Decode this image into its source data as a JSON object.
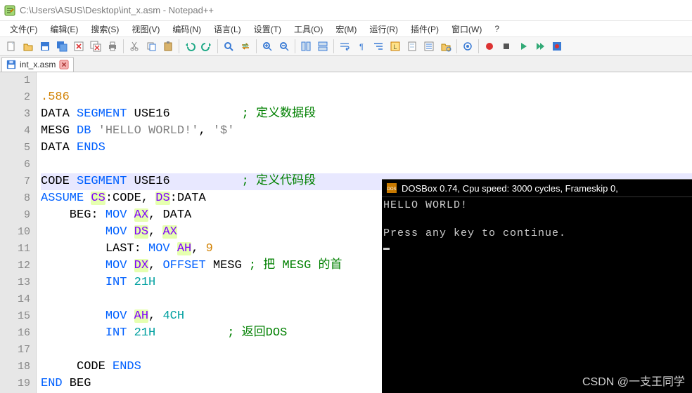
{
  "title": "C:\\Users\\ASUS\\Desktop\\int_x.asm - Notepad++",
  "menus": [
    "文件(F)",
    "编辑(E)",
    "搜索(S)",
    "视图(V)",
    "编码(N)",
    "语言(L)",
    "设置(T)",
    "工具(O)",
    "宏(M)",
    "运行(R)",
    "插件(P)",
    "窗口(W)",
    "?"
  ],
  "tab": {
    "label": "int_x.asm"
  },
  "toolbar_icons": [
    "new-file-icon",
    "open-icon",
    "save-icon",
    "save-all-icon",
    "close-icon",
    "close-all-icon",
    "print-icon",
    "sep",
    "cut-icon",
    "copy-icon",
    "paste-icon",
    "sep",
    "undo-icon",
    "redo-icon",
    "sep",
    "find-icon",
    "replace-icon",
    "sep",
    "zoom-in-icon",
    "zoom-out-icon",
    "sep",
    "sync-v-icon",
    "sync-h-icon",
    "sep",
    "wordwrap-icon",
    "show-all-icon",
    "indent-guide-icon",
    "lang-icon",
    "doc-map-icon",
    "func-list-icon",
    "folder-icon",
    "sep",
    "monitor-icon",
    "sep",
    "record-icon",
    "stop-icon",
    "play-icon",
    "play-multi-icon",
    "save-macro-icon"
  ],
  "code": {
    "lines": [
      {
        "n": 1,
        "hl": false,
        "t": []
      },
      {
        "n": 2,
        "hl": false,
        "t": [
          {
            "c": "f-orange",
            "s": ".586"
          }
        ]
      },
      {
        "n": 3,
        "hl": false,
        "t": [
          {
            "c": "f-black",
            "s": "DATA "
          },
          {
            "c": "f-blue",
            "s": "SEGMENT"
          },
          {
            "c": "f-black",
            "s": " USE16          "
          },
          {
            "c": "f-green",
            "s": "; 定义数据段"
          }
        ]
      },
      {
        "n": 4,
        "hl": false,
        "t": [
          {
            "c": "f-black",
            "s": "MESG "
          },
          {
            "c": "f-blue",
            "s": "DB"
          },
          {
            "c": "f-grey",
            "s": " 'HELLO WORLD!'"
          },
          {
            "c": "f-black",
            "s": ", "
          },
          {
            "c": "f-grey",
            "s": "'$'"
          }
        ]
      },
      {
        "n": 5,
        "hl": false,
        "t": [
          {
            "c": "f-black",
            "s": "DATA "
          },
          {
            "c": "f-blue",
            "s": "ENDS"
          }
        ]
      },
      {
        "n": 6,
        "hl": false,
        "t": []
      },
      {
        "n": 7,
        "hl": true,
        "t": [
          {
            "c": "f-black",
            "s": "CODE "
          },
          {
            "c": "f-blue",
            "s": "SEGMENT"
          },
          {
            "c": "f-black",
            "s": " USE16          "
          },
          {
            "c": "f-green",
            "s": "; 定义代码段"
          }
        ]
      },
      {
        "n": 8,
        "hl": false,
        "t": [
          {
            "c": "f-blue",
            "s": "ASSUME"
          },
          {
            "c": "f-black",
            "s": " "
          },
          {
            "c": "f-purple mark",
            "s": "CS"
          },
          {
            "c": "f-black",
            "s": ":CODE, "
          },
          {
            "c": "f-purple mark",
            "s": "DS"
          },
          {
            "c": "f-black",
            "s": ":DATA"
          }
        ]
      },
      {
        "n": 9,
        "hl": false,
        "t": [
          {
            "c": "f-black",
            "s": "    BEG: "
          },
          {
            "c": "f-blue",
            "s": "MOV"
          },
          {
            "c": "f-black",
            "s": " "
          },
          {
            "c": "f-purple mark",
            "s": "AX"
          },
          {
            "c": "f-black",
            "s": ", DATA"
          }
        ]
      },
      {
        "n": 10,
        "hl": false,
        "t": [
          {
            "c": "f-black",
            "s": "         "
          },
          {
            "c": "f-blue",
            "s": "MOV"
          },
          {
            "c": "f-black",
            "s": " "
          },
          {
            "c": "f-purple mark",
            "s": "DS"
          },
          {
            "c": "f-black",
            "s": ", "
          },
          {
            "c": "f-purple mark",
            "s": "AX"
          }
        ]
      },
      {
        "n": 11,
        "hl": false,
        "t": [
          {
            "c": "f-black",
            "s": "         LAST: "
          },
          {
            "c": "f-blue",
            "s": "MOV"
          },
          {
            "c": "f-black",
            "s": " "
          },
          {
            "c": "f-purple mark",
            "s": "AH"
          },
          {
            "c": "f-black",
            "s": ", "
          },
          {
            "c": "f-orange",
            "s": "9"
          }
        ]
      },
      {
        "n": 12,
        "hl": false,
        "t": [
          {
            "c": "f-black",
            "s": "         "
          },
          {
            "c": "f-blue",
            "s": "MOV"
          },
          {
            "c": "f-black",
            "s": " "
          },
          {
            "c": "f-purple mark",
            "s": "DX"
          },
          {
            "c": "f-black",
            "s": ", "
          },
          {
            "c": "f-blue",
            "s": "OFFSET"
          },
          {
            "c": "f-black",
            "s": " MESG "
          },
          {
            "c": "f-green",
            "s": "; 把 MESG 的首"
          }
        ]
      },
      {
        "n": 13,
        "hl": false,
        "t": [
          {
            "c": "f-black",
            "s": "         "
          },
          {
            "c": "f-blue",
            "s": "INT"
          },
          {
            "c": "f-black",
            "s": " "
          },
          {
            "c": "f-cyan",
            "s": "21H"
          }
        ]
      },
      {
        "n": 14,
        "hl": false,
        "t": []
      },
      {
        "n": 15,
        "hl": false,
        "t": [
          {
            "c": "f-black",
            "s": "         "
          },
          {
            "c": "f-blue",
            "s": "MOV"
          },
          {
            "c": "f-black",
            "s": " "
          },
          {
            "c": "f-purple mark",
            "s": "AH"
          },
          {
            "c": "f-black",
            "s": ", "
          },
          {
            "c": "f-cyan",
            "s": "4CH"
          }
        ]
      },
      {
        "n": 16,
        "hl": false,
        "t": [
          {
            "c": "f-black",
            "s": "         "
          },
          {
            "c": "f-blue",
            "s": "INT"
          },
          {
            "c": "f-black",
            "s": " "
          },
          {
            "c": "f-cyan",
            "s": "21H"
          },
          {
            "c": "f-black",
            "s": "          "
          },
          {
            "c": "f-green",
            "s": "; 返回DOS"
          }
        ]
      },
      {
        "n": 17,
        "hl": false,
        "t": []
      },
      {
        "n": 18,
        "hl": false,
        "t": [
          {
            "c": "f-black",
            "s": "     CODE "
          },
          {
            "c": "f-blue",
            "s": "ENDS"
          }
        ]
      },
      {
        "n": 19,
        "hl": false,
        "t": [
          {
            "c": "f-blue",
            "s": "END"
          },
          {
            "c": "f-black",
            "s": " BEG"
          }
        ]
      }
    ]
  },
  "dosbox": {
    "title": "DOSBox 0.74, Cpu speed:    3000 cycles, Frameskip  0,",
    "line1": "HELLO WORLD!",
    "line2": "Press any key to continue."
  },
  "watermark": "CSDN @一支王同学"
}
